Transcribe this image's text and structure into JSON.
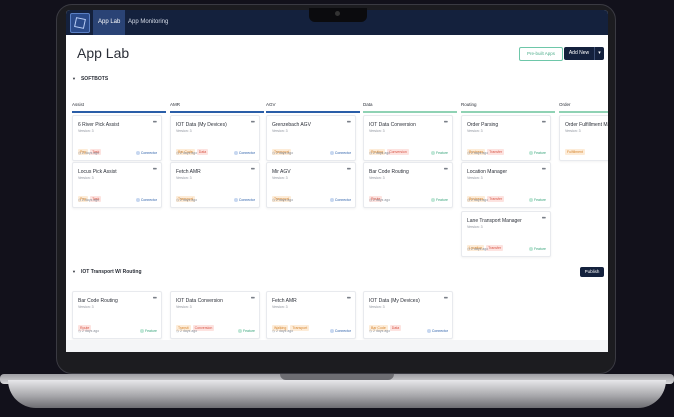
{
  "nav": {
    "tabs": [
      {
        "label": "App Lab"
      },
      {
        "label": "App Monitoring"
      }
    ]
  },
  "header": {
    "title": "App Lab",
    "prebuilt_label": "Pre-built Apps",
    "add_label": "Add New"
  },
  "sections": [
    {
      "title": "SOFTBOTS"
    },
    {
      "title": "IOT Transport W/ Routing",
      "publish_label": "Publish"
    }
  ],
  "columns": [
    {
      "title": "Assist",
      "cards": [
        {
          "title": "6 River Pick Assist",
          "version": "Version: 3",
          "tags": [
            "Pnp",
            "Task"
          ],
          "time": "2 days ago",
          "status": "Connector"
        },
        {
          "title": "Locus Pick Assist",
          "version": "Version: 3",
          "tags": [
            "Pnp",
            "Task"
          ],
          "time": "2 days ago",
          "status": "Connector"
        }
      ]
    },
    {
      "title": "AMR",
      "cards": [
        {
          "title": "IOT Data (My Devices)",
          "version": "Version: 3",
          "tags": [
            "Bar Code",
            "Data"
          ],
          "time": "2 days ago",
          "status": "Connector"
        },
        {
          "title": "Fetch AMR",
          "version": "Version: 3",
          "tags": [
            "Transport"
          ],
          "time": "2 days ago",
          "status": "Connector"
        }
      ]
    },
    {
      "title": "AGV",
      "cards": [
        {
          "title": "Grenzebach AGV",
          "version": "Version: 3",
          "tags": [
            "Transport"
          ],
          "time": "2 days ago",
          "status": "Connector"
        },
        {
          "title": "Mir AGV",
          "version": "Version: 3",
          "tags": [
            "Transport"
          ],
          "time": "2 days ago",
          "status": "Connector"
        }
      ]
    },
    {
      "title": "Data",
      "cards": [
        {
          "title": "IOT Data Conversion",
          "version": "Version: 3",
          "tags": [
            "Routing",
            "Conversion"
          ],
          "time": "2 days ago",
          "status": "Feature"
        },
        {
          "title": "Bar Code Routing",
          "version": "Version: 3",
          "tags": [
            "Route"
          ],
          "time": "2 days ago",
          "status": "Feature"
        }
      ]
    },
    {
      "title": "Routing",
      "cards": [
        {
          "title": "Order Parsing",
          "version": "Version: 3",
          "tags": [
            "Business",
            "Transfer"
          ],
          "time": "2 days ago",
          "status": "Feature"
        },
        {
          "title": "Location Manager",
          "version": "Version: 3",
          "tags": [
            "Business",
            "Transfer"
          ],
          "time": "2 days ago",
          "status": "Feature"
        },
        {
          "title": "Lane Transport Manager",
          "version": "Version: 3",
          "tags": [
            "Location",
            "Transfer"
          ],
          "time": "2 days ago",
          "status": "Feature"
        }
      ]
    },
    {
      "title": "Order",
      "cards": [
        {
          "title": "Order Fulfillment Ma",
          "version": "Version: 3",
          "tags": [
            "Fulfillment"
          ]
        }
      ]
    }
  ],
  "iot_cards": [
    {
      "title": "Bar Code Routing",
      "version": "Version: 3",
      "tags": [
        "Route"
      ],
      "time": "2 days ago",
      "status": "Feature"
    },
    {
      "title": "IOT Data Conversion",
      "version": "Version: 3",
      "tags": [
        "Transit",
        "Conversion"
      ],
      "time": "2 days ago",
      "status": "Feature"
    },
    {
      "title": "Fetch AMR",
      "version": "Version: 3",
      "tags": [
        "Walking",
        "Transport"
      ],
      "time": "2 days ago",
      "status": "Connector"
    },
    {
      "title": "IOT Data (My Devices)",
      "version": "Version: 3",
      "tags": [
        "Bar Code",
        "Data"
      ],
      "time": "2 days ago",
      "status": "Connector"
    }
  ],
  "colors": {
    "nav_bg": "#14213d",
    "accent_blue": "#2a5ea8",
    "accent_green": "#3aa57c",
    "tag_orange": "#d6852f",
    "tag_red": "#d85545"
  }
}
